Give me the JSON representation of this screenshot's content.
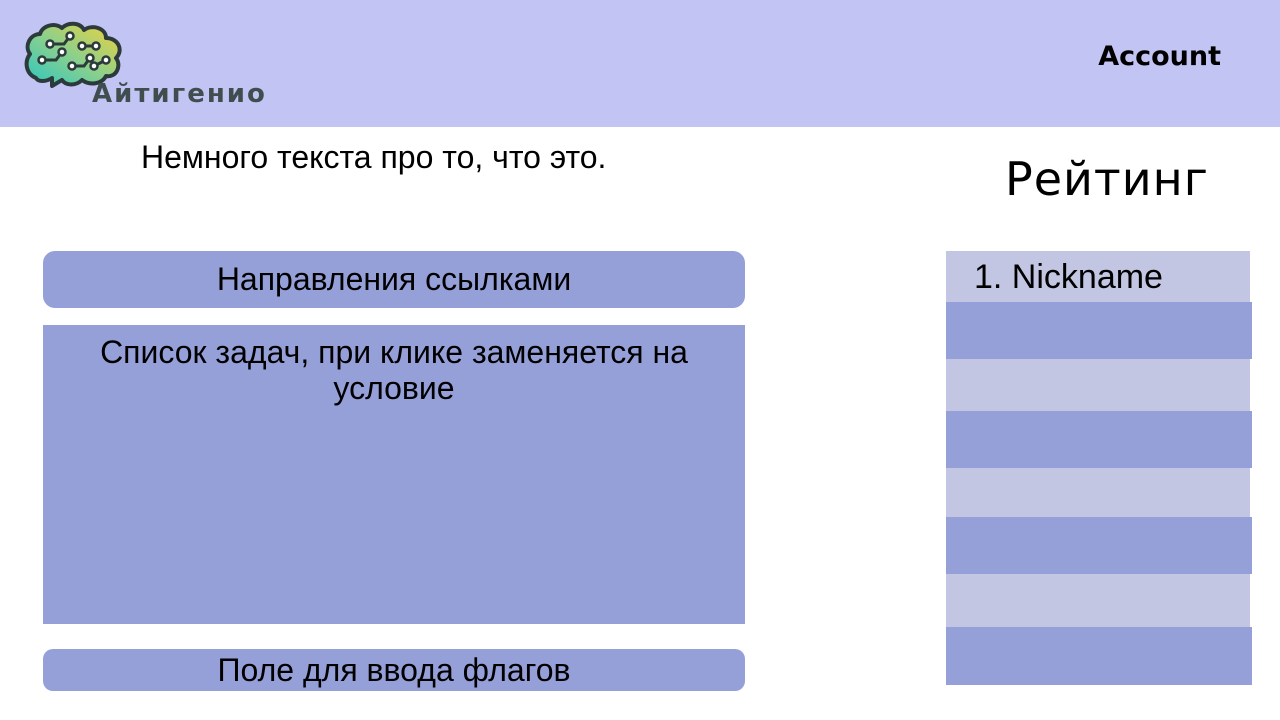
{
  "header": {
    "logo_text": "Айтигенио",
    "logo_icon": "brain-circuit-icon",
    "account_label": "Account"
  },
  "intro": {
    "text": "Немного текста про то, что это."
  },
  "main": {
    "directions_label": "Направления ссылками",
    "tasks_text": "Список задач, при клике заменяется на условие",
    "flag_input_placeholder": "Поле для ввода флагов"
  },
  "rating": {
    "title": "Рейтинг",
    "rows": [
      {
        "label": "1. Nickname"
      },
      {
        "label": ""
      },
      {
        "label": ""
      },
      {
        "label": ""
      },
      {
        "label": ""
      },
      {
        "label": ""
      },
      {
        "label": ""
      },
      {
        "label": ""
      }
    ]
  },
  "colors": {
    "header_bg": "#c2c5f3",
    "panel": "#959fd8",
    "row_light": "#c3c6e3"
  }
}
